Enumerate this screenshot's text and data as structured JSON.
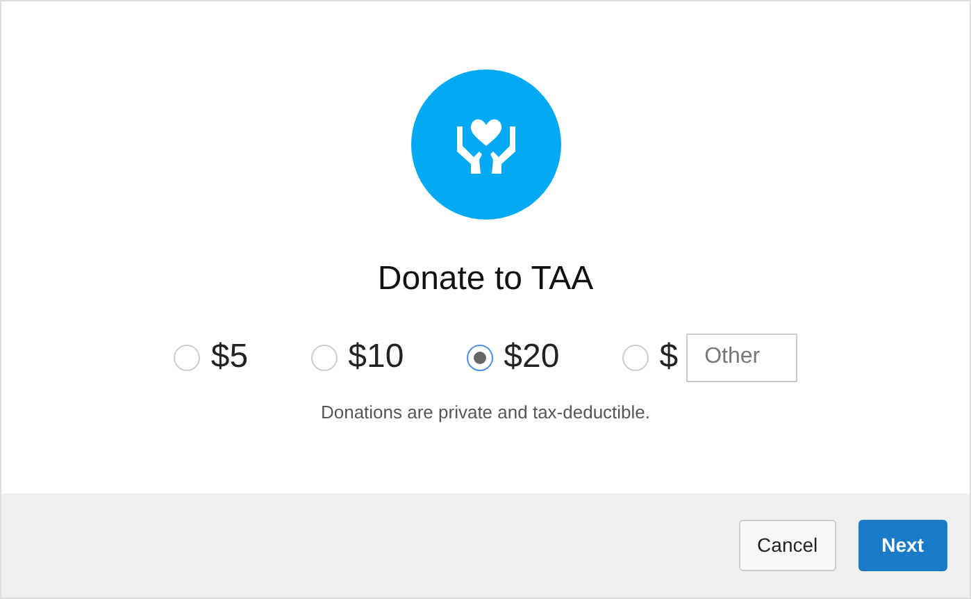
{
  "title": "Donate to TAA",
  "options": [
    {
      "kind": "amount",
      "label": "$5",
      "selected": false
    },
    {
      "kind": "amount",
      "label": "$10",
      "selected": false
    },
    {
      "kind": "amount",
      "label": "$20",
      "selected": true
    },
    {
      "kind": "other",
      "label": "$",
      "placeholder": "Other",
      "selected": false
    }
  ],
  "note": "Donations are private and tax-deductible.",
  "buttons": [
    {
      "kind": "secondary",
      "label": "Cancel"
    },
    {
      "kind": "primary",
      "label": "Next"
    }
  ]
}
